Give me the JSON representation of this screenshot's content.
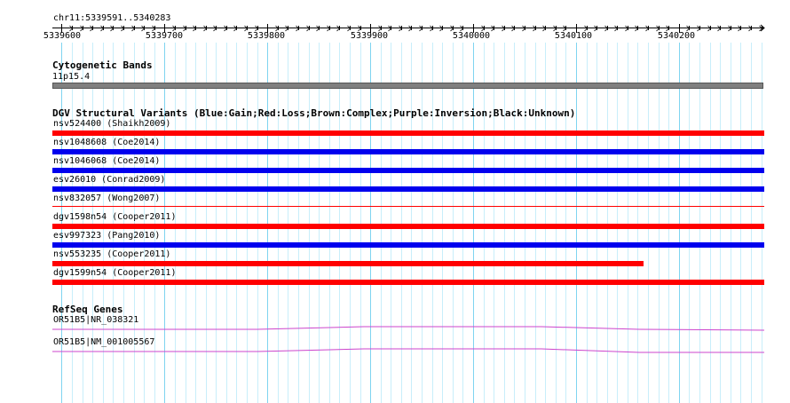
{
  "region": {
    "label": "chr11:5339591..5340283",
    "start": 5339591,
    "end": 5340283
  },
  "ruler": {
    "ticks": [
      "5339600",
      "5339700",
      "5339800",
      "5339900",
      "5340000",
      "5340100",
      "5340200"
    ]
  },
  "tracks": {
    "cytoband": {
      "title": "Cytogenetic Bands",
      "band": "11p15.4",
      "color": "#808080"
    },
    "dgv": {
      "title": "DGV Structural Variants (Blue:Gain;Red:Loss;Brown:Complex;Purple:Inversion;Black:Unknown)",
      "colors": {
        "gain": "#0000ee",
        "loss": "#ff0000"
      },
      "variants": [
        {
          "label": "nsv524400 (Shaikh2009)",
          "type": "loss",
          "end_fraction": 1.0,
          "style": "thick"
        },
        {
          "label": "nsv1048608 (Coe2014)",
          "type": "gain",
          "end_fraction": 1.0,
          "style": "thick"
        },
        {
          "label": "nsv1046068 (Coe2014)",
          "type": "gain",
          "end_fraction": 1.0,
          "style": "thick"
        },
        {
          "label": "esv26010 (Conrad2009)",
          "type": "gain",
          "end_fraction": 1.0,
          "style": "thick"
        },
        {
          "label": "nsv832057 (Wong2007)",
          "type": "loss",
          "end_fraction": 1.0,
          "style": "thin"
        },
        {
          "label": "dgv1598n54 (Cooper2011)",
          "type": "loss",
          "end_fraction": 1.0,
          "style": "thick"
        },
        {
          "label": "esv997323 (Pang2010)",
          "type": "gain",
          "end_fraction": 1.0,
          "style": "thick"
        },
        {
          "label": "nsv553235 (Cooper2011)",
          "type": "loss",
          "end_fraction": 0.83,
          "style": "thick"
        },
        {
          "label": "dgv1599n54 (Cooper2011)",
          "type": "loss",
          "end_fraction": 1.0,
          "style": "thick"
        }
      ]
    },
    "refseq": {
      "title": "RefSeq Genes",
      "color": "#cc44cc",
      "genes": [
        {
          "label": "OR51B5|NR_038321"
        },
        {
          "label": "OR51B5|NM_001005567"
        }
      ]
    }
  }
}
